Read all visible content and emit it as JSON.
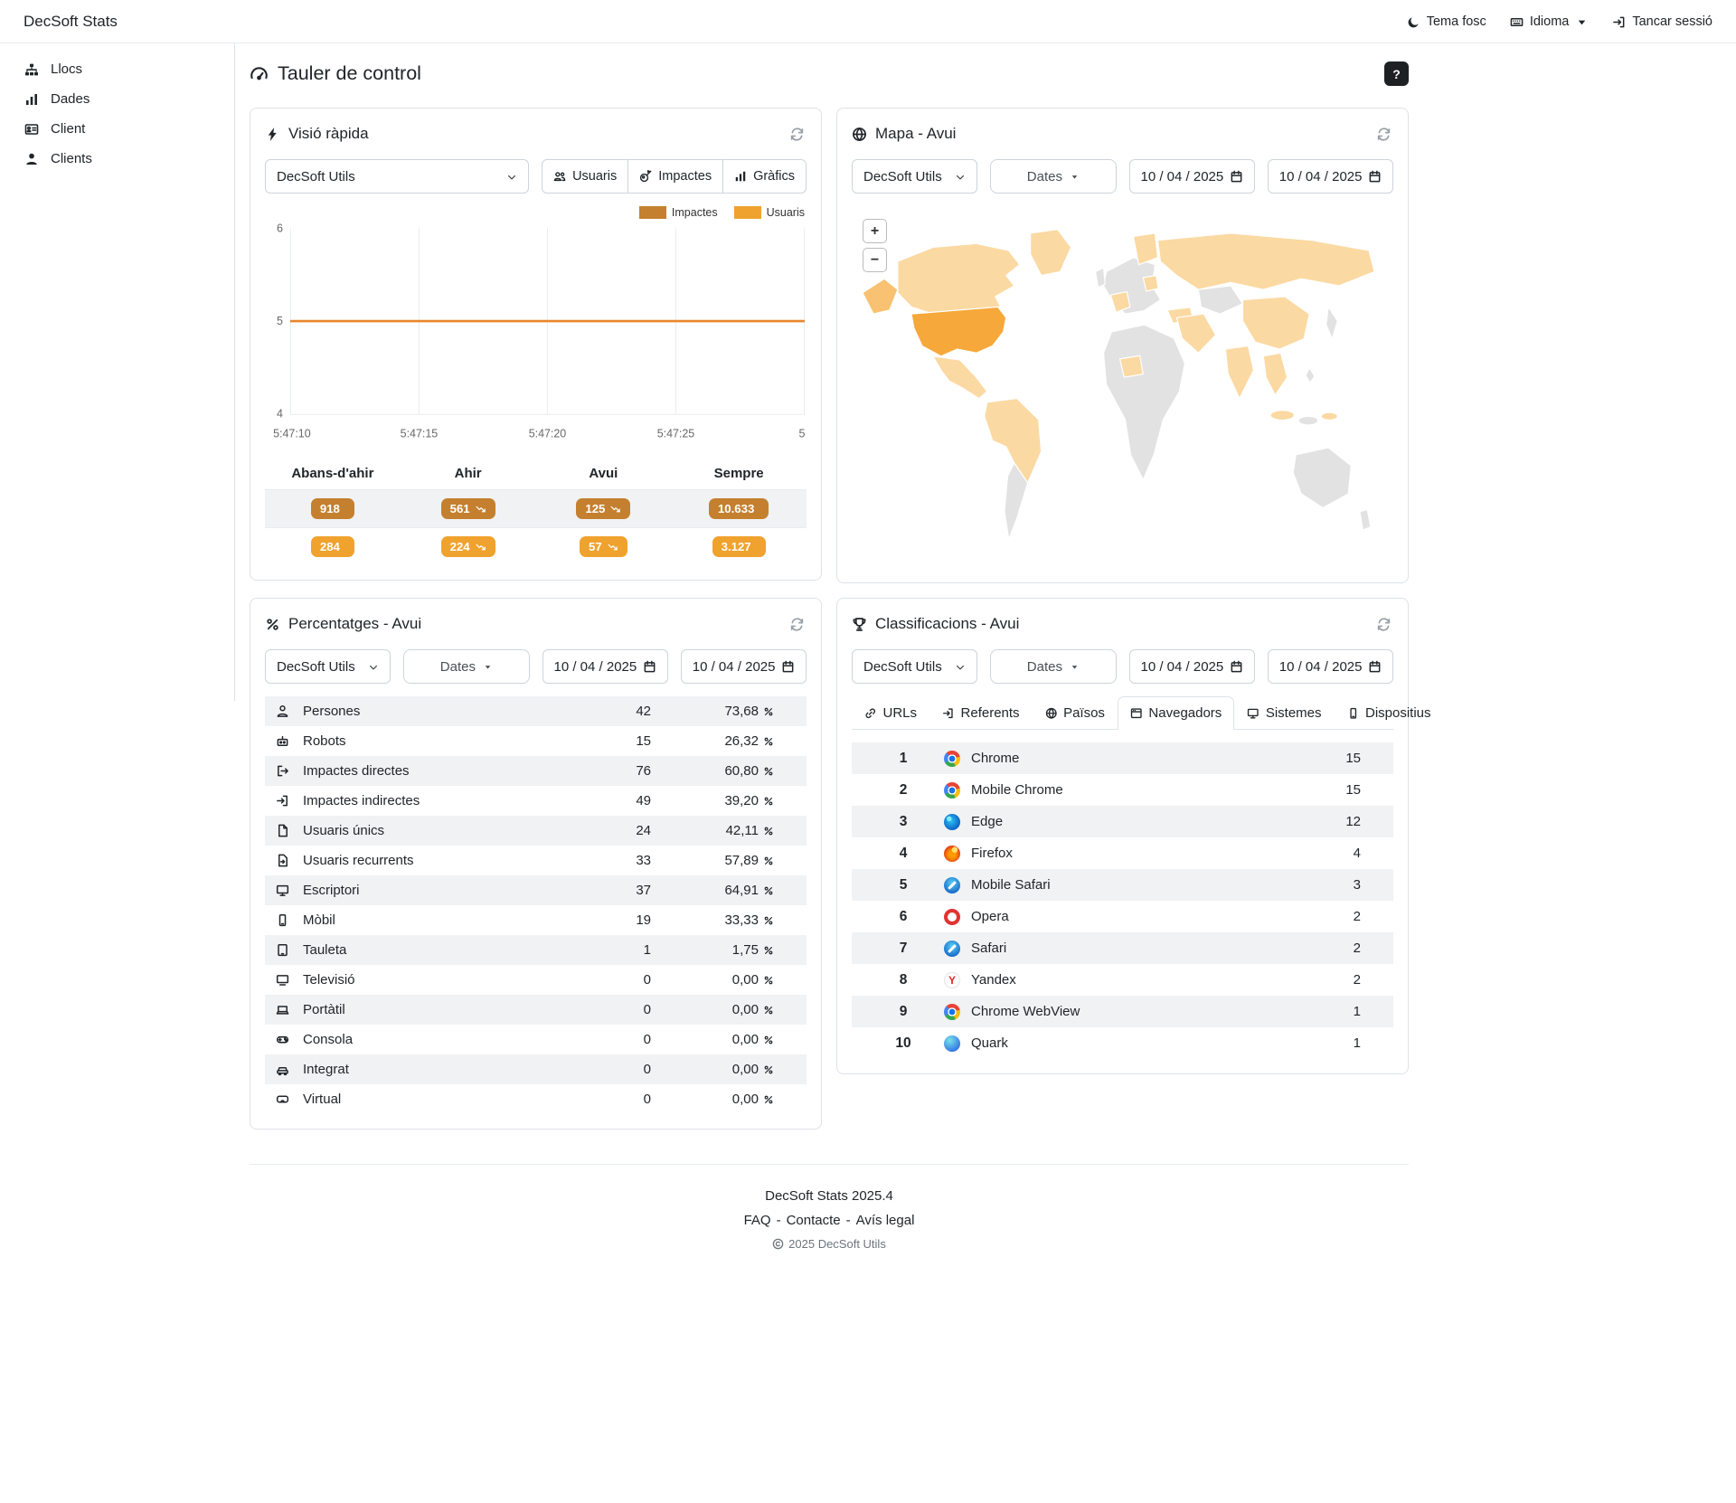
{
  "colors": {
    "impactes_badge": "#c4802f",
    "usuaris_badge": "#f0a22e",
    "chart_line": "#e8862c",
    "map_high": "#f6a83a",
    "map_mid": "#f8c272",
    "map_low": "#fbd9a2",
    "map_none": "#e2e2e2"
  },
  "navbar": {
    "brand": "DecSoft Stats",
    "theme_toggle": "Tema fosc",
    "language": "Idioma",
    "logout": "Tancar sessió"
  },
  "sidebar": {
    "items": [
      {
        "label": "Llocs",
        "icon": "sitemap-icon",
        "name": "sidebar-item-llocs"
      },
      {
        "label": "Dades",
        "icon": "bar-chart-icon",
        "name": "sidebar-item-dades"
      },
      {
        "label": "Client",
        "icon": "id-card-icon",
        "name": "sidebar-item-client"
      },
      {
        "label": "Clients",
        "icon": "user-icon",
        "name": "sidebar-item-clients"
      }
    ]
  },
  "page": {
    "title": "Tauler de control",
    "help_button": "?"
  },
  "quick_view": {
    "title": "Visió ràpida",
    "site": "DecSoft Utils",
    "view_buttons": [
      {
        "label": "Usuaris",
        "icon": "users-icon",
        "name": "view-button-usuaris"
      },
      {
        "label": "Impactes",
        "icon": "meteor-icon",
        "name": "view-button-impactes"
      },
      {
        "label": "Gràfics",
        "icon": "bar-chart-icon",
        "name": "view-button-grafics"
      }
    ],
    "legend": [
      {
        "label": "Impactes",
        "color": "#c4802f"
      },
      {
        "label": "Usuaris",
        "color": "#f0a22e"
      }
    ],
    "chart_data": {
      "type": "line",
      "x": [
        "5:47:10",
        "5:47:15",
        "5:47:20",
        "5:47:25",
        "5"
      ],
      "yticks": [
        "6",
        "5",
        "4"
      ],
      "ylim": [
        4,
        6
      ],
      "series": [
        {
          "name": "Impactes",
          "values": [
            5,
            5,
            5,
            5,
            5
          ],
          "color": "#e8862c"
        }
      ]
    },
    "summary": {
      "headers": [
        "Abans-d'ahir",
        "Ahir",
        "Avui",
        "Sempre"
      ],
      "impactes": [
        {
          "value": "918"
        },
        {
          "value": "561",
          "trend_icon": "trend-down-icon"
        },
        {
          "value": "125",
          "trend_icon": "trend-down-icon"
        },
        {
          "value": "10.633"
        }
      ],
      "usuaris": [
        {
          "value": "284"
        },
        {
          "value": "224",
          "trend_icon": "trend-down-icon"
        },
        {
          "value": "57",
          "trend_icon": "trend-down-icon"
        },
        {
          "value": "3.127"
        }
      ]
    }
  },
  "map": {
    "title": "Mapa - Avui",
    "site": "DecSoft Utils",
    "dates_button": "Dates",
    "date_from": "10 / 04 / 2025",
    "date_to": "10 / 04 / 2025",
    "zoom_in": "+",
    "zoom_out": "−"
  },
  "percentages": {
    "title": "Percentatges - Avui",
    "site": "DecSoft Utils",
    "dates_button": "Dates",
    "date_from": "10 / 04 / 2025",
    "date_to": "10 / 04 / 2025",
    "rows": [
      {
        "label": "Persones",
        "icon": "person-icon",
        "count": "42",
        "pct": "73,68"
      },
      {
        "label": "Robots",
        "icon": "robot-icon",
        "count": "15",
        "pct": "26,32"
      },
      {
        "label": "Impactes directes",
        "icon": "arrow-out-icon",
        "count": "76",
        "pct": "60,80"
      },
      {
        "label": "Impactes indirectes",
        "icon": "arrow-in-icon",
        "count": "49",
        "pct": "39,20"
      },
      {
        "label": "Usuaris únics",
        "icon": "file-icon",
        "count": "24",
        "pct": "42,11"
      },
      {
        "label": "Usuaris recurrents",
        "icon": "file-return-icon",
        "count": "33",
        "pct": "57,89"
      },
      {
        "label": "Escriptori",
        "icon": "desktop-icon",
        "count": "37",
        "pct": "64,91"
      },
      {
        "label": "Mòbil",
        "icon": "mobile-icon",
        "count": "19",
        "pct": "33,33"
      },
      {
        "label": "Tauleta",
        "icon": "tablet-icon",
        "count": "1",
        "pct": "1,75"
      },
      {
        "label": "Televisió",
        "icon": "tv-icon",
        "count": "0",
        "pct": "0,00"
      },
      {
        "label": "Portàtil",
        "icon": "laptop-icon",
        "count": "0",
        "pct": "0,00"
      },
      {
        "label": "Consola",
        "icon": "gamepad-icon",
        "count": "0",
        "pct": "0,00"
      },
      {
        "label": "Integrat",
        "icon": "car-icon",
        "count": "0",
        "pct": "0,00"
      },
      {
        "label": "Virtual",
        "icon": "vr-icon",
        "count": "0",
        "pct": "0,00"
      }
    ]
  },
  "classifications": {
    "title": "Classificacions - Avui",
    "site": "DecSoft Utils",
    "dates_button": "Dates",
    "date_from": "10 / 04 / 2025",
    "date_to": "10 / 04 / 2025",
    "tabs": [
      {
        "label": "URLs",
        "icon": "link-icon",
        "active": false,
        "name": "tab-urls"
      },
      {
        "label": "Referents",
        "icon": "arrow-in-icon",
        "active": false,
        "name": "tab-referents"
      },
      {
        "label": "Països",
        "icon": "globe-icon",
        "active": false,
        "name": "tab-paisos"
      },
      {
        "label": "Navegadors",
        "icon": "browser-icon",
        "active": true,
        "name": "tab-navegadors"
      },
      {
        "label": "Sistemes",
        "icon": "display-icon",
        "active": false,
        "name": "tab-sistemes"
      },
      {
        "label": "Dispositius",
        "icon": "mobile-icon",
        "active": false,
        "name": "tab-dispositius"
      }
    ],
    "rows": [
      {
        "rank": "1",
        "label": "Chrome",
        "icon": "chrome-icon",
        "count": "15"
      },
      {
        "rank": "2",
        "label": "Mobile Chrome",
        "icon": "chrome-icon",
        "count": "15"
      },
      {
        "rank": "3",
        "label": "Edge",
        "icon": "edge-icon",
        "count": "12"
      },
      {
        "rank": "4",
        "label": "Firefox",
        "icon": "firefox-icon",
        "count": "4"
      },
      {
        "rank": "5",
        "label": "Mobile Safari",
        "icon": "safari-icon",
        "count": "3"
      },
      {
        "rank": "6",
        "label": "Opera",
        "icon": "opera-icon",
        "count": "2"
      },
      {
        "rank": "7",
        "label": "Safari",
        "icon": "safari-icon",
        "count": "2"
      },
      {
        "rank": "8",
        "label": "Yandex",
        "icon": "yandex-icon",
        "count": "2"
      },
      {
        "rank": "9",
        "label": "Chrome WebView",
        "icon": "chrome-icon",
        "count": "1"
      },
      {
        "rank": "10",
        "label": "Quark",
        "icon": "quark-icon",
        "count": "1"
      }
    ]
  },
  "footer": {
    "version": "DecSoft Stats 2025.4",
    "links": [
      "FAQ",
      "Contacte",
      "Avís legal"
    ],
    "separator": "-",
    "copyright": "2025 DecSoft Utils"
  }
}
